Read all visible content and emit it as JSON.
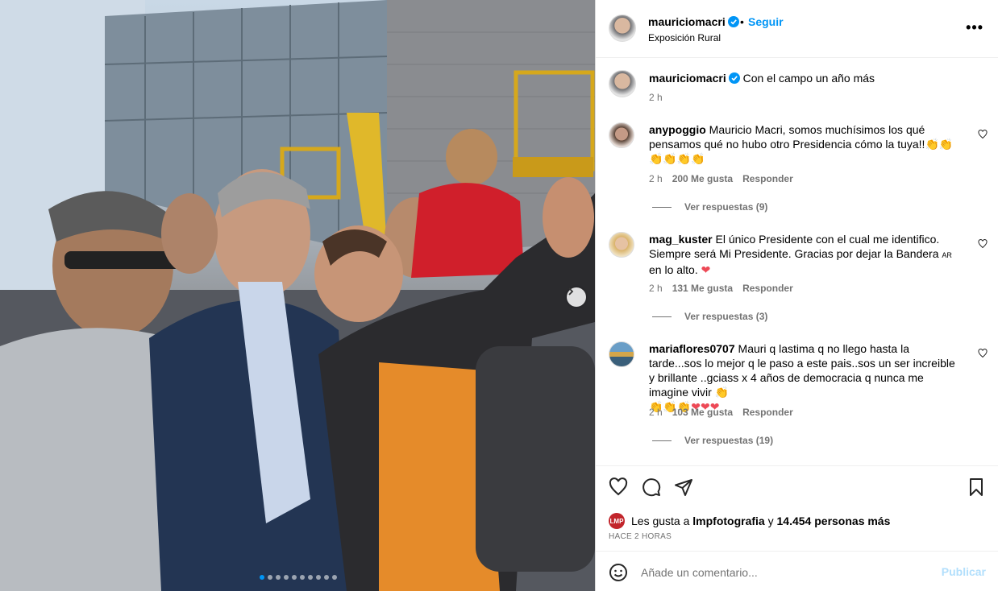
{
  "post": {
    "author": "mauriciomacri",
    "follow_label": "Seguir",
    "separator": "•",
    "location": "Exposición Rural",
    "more_label": "•••",
    "caption": "Con el campo un año más",
    "caption_time": "2 h",
    "carousel": {
      "count": 10,
      "active_index": 0
    }
  },
  "comments": [
    {
      "user": "anypoggio",
      "text": "Mauricio Macri, somos muchísimos los qué pensamos qué no hubo otro Presidencia cómo la tuya!!",
      "emoji_trail": "👏👏",
      "emoji_line": "👏👏👏👏",
      "time": "2 h",
      "likes": "200 Me gusta",
      "reply_label": "Responder",
      "view_replies": "Ver respuestas (9)"
    },
    {
      "user": "mag_kuster",
      "text": "El único Presidente con el cual me identifico. Siempre será Mi Presidente. Gracias por dejar la Bandera",
      "flag": "AR",
      "text_end": "en lo alto.",
      "emoji_trail": "❤",
      "time": "2 h",
      "likes": "131 Me gusta",
      "reply_label": "Responder",
      "view_replies": "Ver respuestas (3)"
    },
    {
      "user": "mariaflores0707",
      "text": "Mauri q lastima q no llego hasta la tarde...sos lo mejor q le paso a este pais..sos un ser increible y brillante ..gciass x 4 años de democracia q nunca me imagine vivir",
      "emoji_trail": "👏",
      "emoji_line_claps": "👏👏👏",
      "emoji_line_hearts": "❤❤❤",
      "time": "2 h",
      "likes": "103 Me gusta",
      "reply_label": "Responder",
      "view_replies": "Ver respuestas (19)"
    }
  ],
  "likes_summary": {
    "prefix": "Les gusta a",
    "first_user": "lmpfotografia",
    "connector": "y",
    "others": "14.454 personas más",
    "avatar_text": "LMP"
  },
  "time_ago": "HACE 2 HORAS",
  "comment_box": {
    "placeholder": "Añade un comentario...",
    "publish_label": "Publicar"
  },
  "colors": {
    "link_blue": "#0095f6",
    "publish_disabled": "#b2dffc",
    "heart_red": "#ed4956",
    "meta_gray": "#737373"
  }
}
